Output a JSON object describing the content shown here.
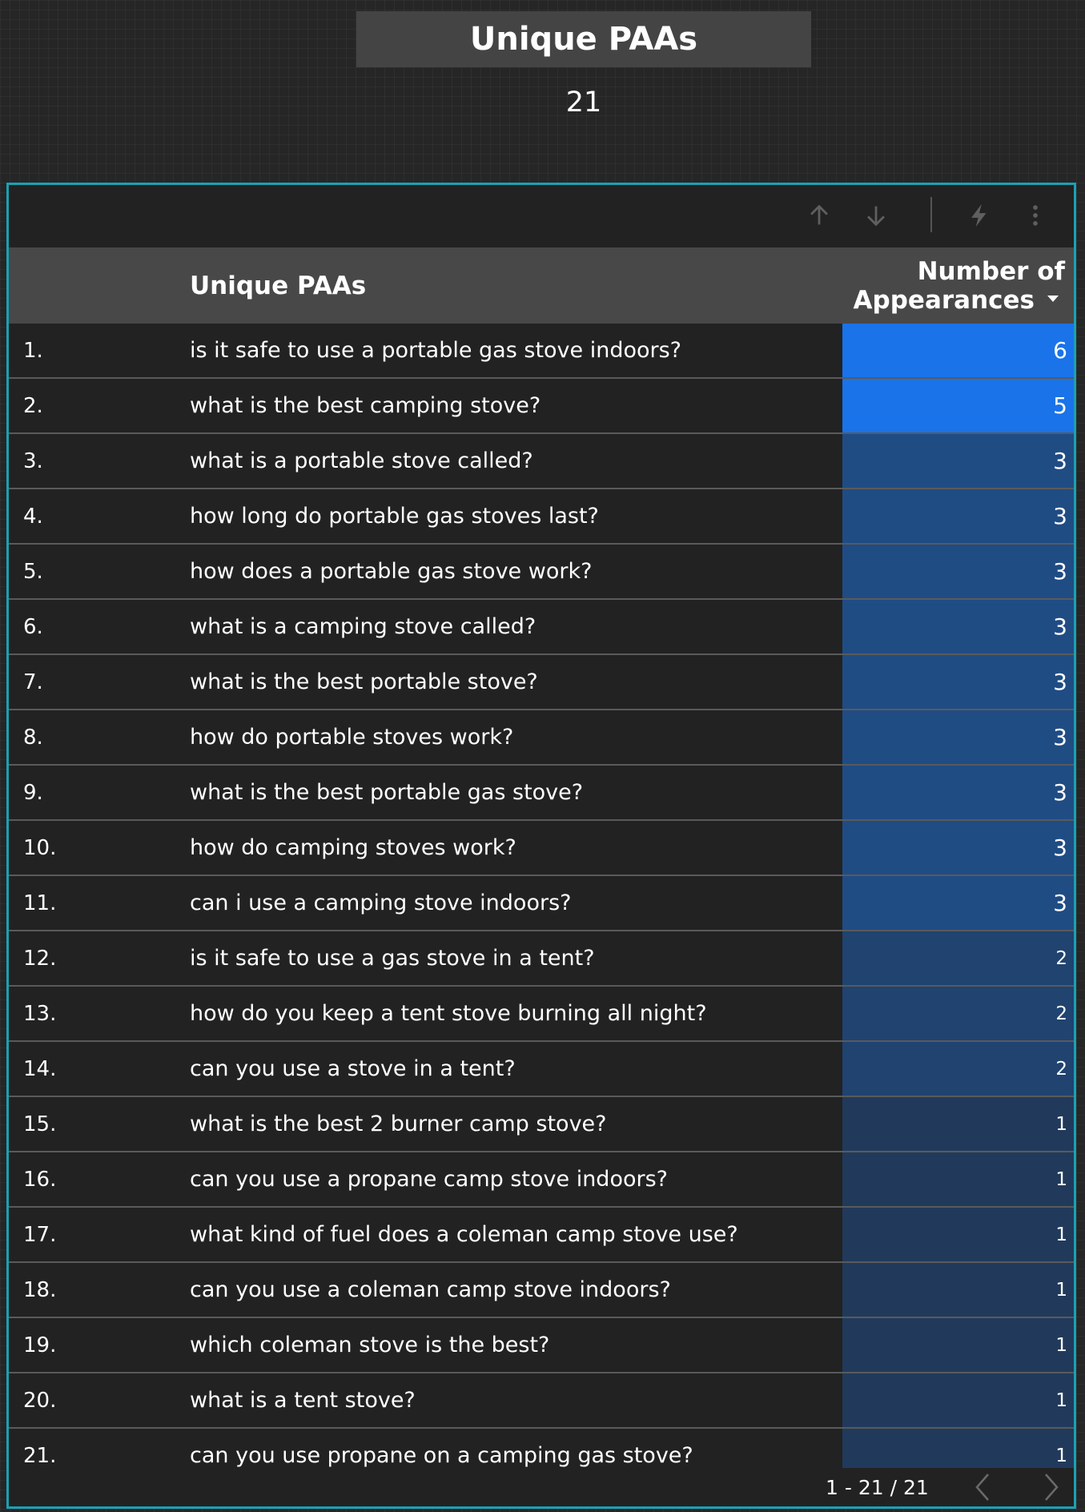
{
  "scorecard": {
    "title": "Unique PAAs",
    "value": "21"
  },
  "toolbar": {
    "icons": [
      "arrow-up-icon",
      "arrow-down-icon",
      "lightning-icon",
      "more-vert-icon"
    ]
  },
  "table": {
    "columns": {
      "question": "Unique PAAs",
      "count_line1": "Number of",
      "count_line2": "Appearances",
      "sort": "descending"
    },
    "max_count": 6,
    "bar_color_top": "#1a73e8",
    "bar_color_low": "#213a5c",
    "rows": [
      {
        "index": "1.",
        "question": "is it safe to use a portable gas stove indoors?",
        "count": 6
      },
      {
        "index": "2.",
        "question": "what is the best camping stove?",
        "count": 5
      },
      {
        "index": "3.",
        "question": "what is a portable stove called?",
        "count": 3
      },
      {
        "index": "4.",
        "question": "how long do portable gas stoves last?",
        "count": 3
      },
      {
        "index": "5.",
        "question": "how does a portable gas stove work?",
        "count": 3
      },
      {
        "index": "6.",
        "question": "what is a camping stove called?",
        "count": 3
      },
      {
        "index": "7.",
        "question": "what is the best portable stove?",
        "count": 3
      },
      {
        "index": "8.",
        "question": "how do portable stoves work?",
        "count": 3
      },
      {
        "index": "9.",
        "question": "what is the best portable gas stove?",
        "count": 3
      },
      {
        "index": "10.",
        "question": "how do camping stoves work?",
        "count": 3
      },
      {
        "index": "11.",
        "question": "can i use a camping stove indoors?",
        "count": 3
      },
      {
        "index": "12.",
        "question": "is it safe to use a gas stove in a tent?",
        "count": 2
      },
      {
        "index": "13.",
        "question": "how do you keep a tent stove burning all night?",
        "count": 2
      },
      {
        "index": "14.",
        "question": "can you use a stove in a tent?",
        "count": 2
      },
      {
        "index": "15.",
        "question": "what is the best 2 burner camp stove?",
        "count": 1
      },
      {
        "index": "16.",
        "question": "can you use a propane camp stove indoors?",
        "count": 1
      },
      {
        "index": "17.",
        "question": "what kind of fuel does a coleman camp stove use?",
        "count": 1
      },
      {
        "index": "18.",
        "question": "can you use a coleman camp stove indoors?",
        "count": 1
      },
      {
        "index": "19.",
        "question": "which coleman stove is the best?",
        "count": 1
      },
      {
        "index": "20.",
        "question": "what is a tent stove?",
        "count": 1
      },
      {
        "index": "21.",
        "question": "can you use propane on a camping gas stove?",
        "count": 1
      }
    ]
  },
  "pagination": {
    "label": "1 - 21 / 21",
    "prev_icon": "chevron-left-icon",
    "next_icon": "chevron-right-icon"
  },
  "colors": {
    "panel_border": "#1aa1b4",
    "header_bg": "#484848",
    "title_bg": "#444444"
  }
}
